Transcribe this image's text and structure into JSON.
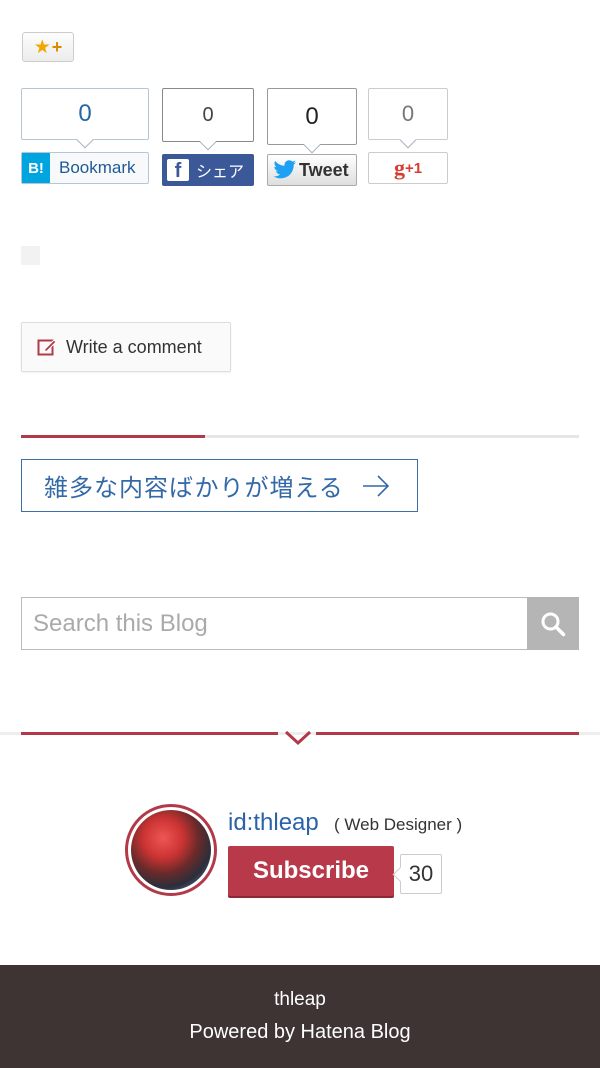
{
  "share": {
    "hatena": {
      "count": "0",
      "label": "Bookmark",
      "logo": "B!"
    },
    "facebook": {
      "count": "0",
      "label": "シェア",
      "logo": "f"
    },
    "twitter": {
      "count": "0",
      "label": "Tweet"
    },
    "google": {
      "count": "0",
      "g": "g",
      "plus": "+1"
    }
  },
  "comment": {
    "label": "Write a comment"
  },
  "pager": {
    "next_label": "雑多な内容ばかりが増える"
  },
  "search": {
    "placeholder": "Search this Blog"
  },
  "author": {
    "id": "id:thleap",
    "role": "( Web Designer )",
    "subscribe_label": "Subscribe",
    "subscriber_count": "30"
  },
  "footer": {
    "blog_name": "thleap",
    "powered_by": "Powered by Hatena Blog"
  },
  "colors": {
    "accent": "#b23a48",
    "link": "#3369a7",
    "hatena": "#00a4de",
    "facebook": "#3b5998",
    "twitter": "#1da1f2",
    "google": "#d73d32",
    "footer_bg": "#3e3433"
  },
  "icons": [
    "star-add-icon",
    "pencil-icon",
    "arrow-right-icon",
    "search-icon",
    "chevron-down-icon",
    "twitter-bird-icon"
  ]
}
